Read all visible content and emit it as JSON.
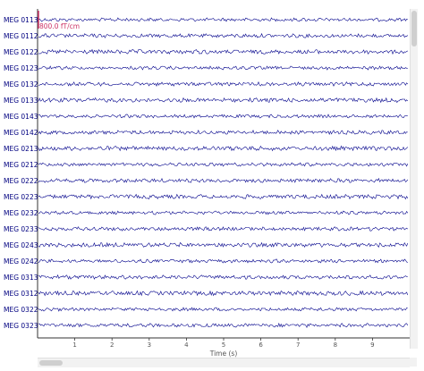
{
  "window": {
    "background": "#ffffff"
  },
  "channels": [
    "MEG 0113",
    "MEG 0112",
    "MEG 0122",
    "MEG 0123",
    "MEG 0132",
    "MEG 0133",
    "MEG 0143",
    "MEG 0142",
    "MEG 0213",
    "MEG 0212",
    "MEG 0222",
    "MEG 0223",
    "MEG 0232",
    "MEG 0233",
    "MEG 0243",
    "MEG 0242",
    "MEG 0313",
    "MEG 0312",
    "MEG 0322",
    "MEG 0323"
  ],
  "scale_bar": {
    "label": "800.0 fT/cm",
    "color": "#cc3366"
  },
  "x_axis": {
    "label": "Time (s)",
    "ticks": [
      "1",
      "2",
      "3",
      "4",
      "5",
      "6",
      "7",
      "8",
      "9"
    ],
    "range": [
      0,
      10
    ]
  },
  "colors": {
    "trace": "#00008b",
    "axis": "#333333",
    "tick_text": "#555555"
  },
  "scrollbars": {
    "vertical": true,
    "horizontal": true
  }
}
